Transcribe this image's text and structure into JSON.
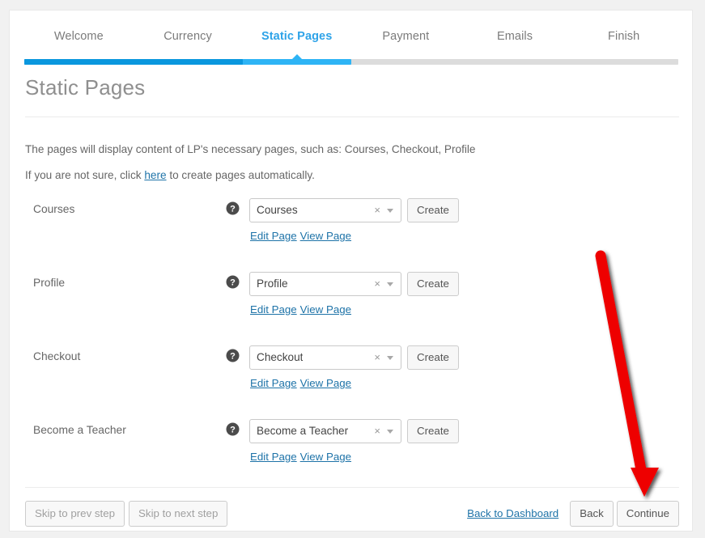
{
  "wizard": {
    "steps": [
      {
        "label": "Welcome",
        "active": false
      },
      {
        "label": "Currency",
        "active": false
      },
      {
        "label": "Static Pages",
        "active": true
      },
      {
        "label": "Payment",
        "active": false
      },
      {
        "label": "Emails",
        "active": false
      },
      {
        "label": "Finish",
        "active": false
      }
    ],
    "progress": {
      "completed_pct": "33.4%",
      "current_pct": "50%",
      "marker_pct": "41.6%",
      "color_done": "#0a97de",
      "color_current": "#2eb4f5",
      "color_track": "#dcdcdc"
    }
  },
  "page": {
    "title": "Static Pages",
    "intro_line_1": "The pages will display content of LP's necessary pages, such as: Courses, Checkout, Profile",
    "intro_line_2_before": "If you are not sure, click ",
    "intro_line_2_link": "here",
    "intro_line_2_after": " to create pages automatically."
  },
  "rows": [
    {
      "label": "Courses",
      "help_icon": "help-circle-icon",
      "select_value": "Courses",
      "clear_glyph": "×",
      "create_label": "Create",
      "edit_link": "Edit Page",
      "view_link": "View Page"
    },
    {
      "label": "Profile",
      "help_icon": "help-circle-icon",
      "select_value": "Profile",
      "clear_glyph": "×",
      "create_label": "Create",
      "edit_link": "Edit Page",
      "view_link": "View Page"
    },
    {
      "label": "Checkout",
      "help_icon": "help-circle-icon",
      "select_value": "Checkout",
      "clear_glyph": "×",
      "create_label": "Create",
      "edit_link": "Edit Page",
      "view_link": "View Page"
    },
    {
      "label": "Become a Teacher",
      "help_icon": "help-circle-icon",
      "select_value": "Become a Teacher",
      "clear_glyph": "×",
      "create_label": "Create",
      "edit_link": "Edit Page",
      "view_link": "View Page"
    }
  ],
  "footer": {
    "skip_prev": "Skip to prev step",
    "skip_next": "Skip to next step",
    "back_to_dashboard": "Back to Dashboard",
    "back": "Back",
    "continue": "Continue"
  },
  "annotation": {
    "arrow_color": "#ee0000",
    "points_to": "Continue"
  }
}
